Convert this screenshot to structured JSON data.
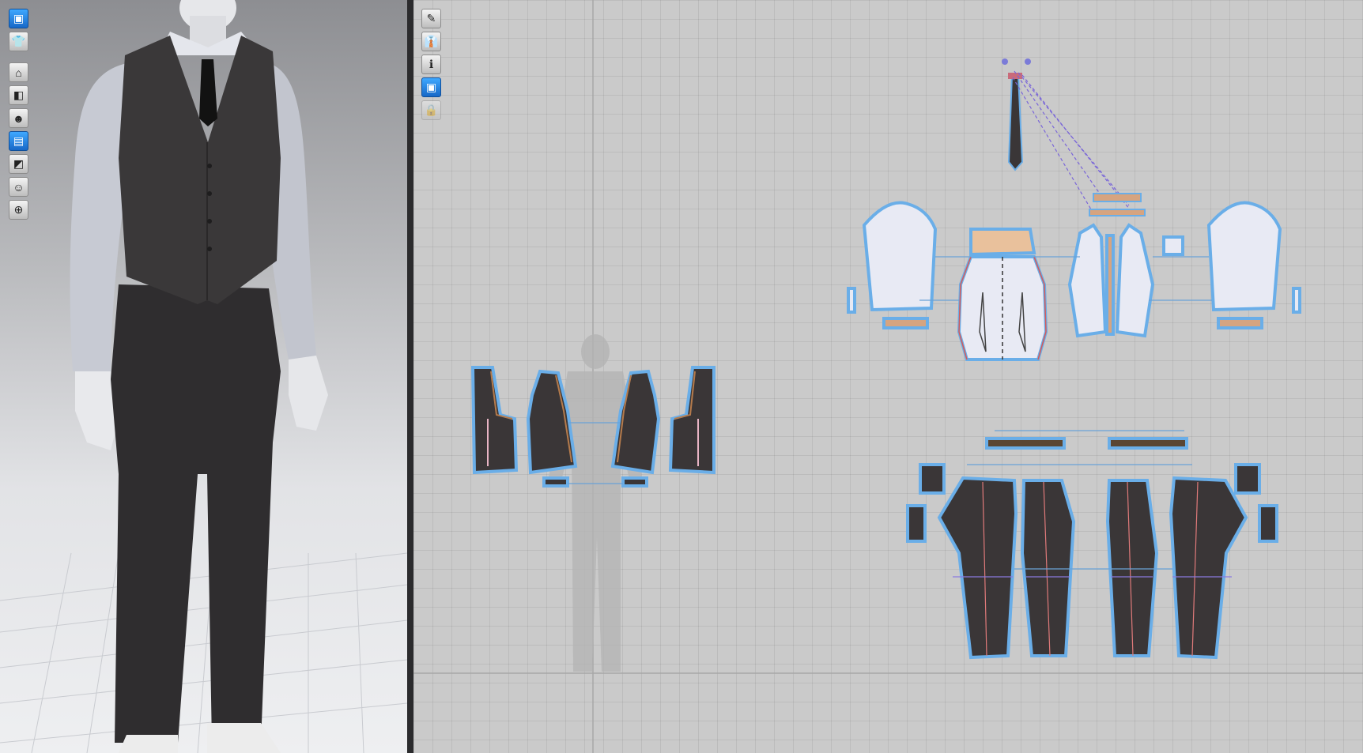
{
  "app": {
    "accent_color": "#2f8ef0",
    "pattern_outline_color": "#6aaee8",
    "fabric_dark_color": "#3a3637",
    "fabric_light_color": "#e8eaf4",
    "trim_color": "#d6a480"
  },
  "viewport_3d": {
    "toolbar": [
      {
        "name": "simulation-icon",
        "glyph": "▣",
        "active": true
      },
      {
        "name": "garment-icon",
        "glyph": "👕",
        "active": false
      },
      {
        "name": "avatar-visibility-icon",
        "glyph": "⌂",
        "active": false
      },
      {
        "name": "texture-icon",
        "glyph": "◧",
        "active": false
      },
      {
        "name": "avatar-icon",
        "glyph": "☻",
        "active": false
      },
      {
        "name": "surface-icon",
        "glyph": "▤",
        "active": true
      },
      {
        "name": "shading-icon",
        "glyph": "◩",
        "active": false
      },
      {
        "name": "skin-icon",
        "glyph": "☺",
        "active": false
      },
      {
        "name": "globe-icon",
        "glyph": "⊕",
        "active": false
      }
    ]
  },
  "viewport_2d": {
    "toolbar": [
      {
        "name": "pen-icon",
        "glyph": "✎",
        "active": false
      },
      {
        "name": "shirt-visibility-icon",
        "glyph": "👔",
        "active": false
      },
      {
        "name": "info-icon",
        "glyph": "ℹ",
        "active": false
      },
      {
        "name": "thickness-icon",
        "glyph": "▣",
        "active": true
      },
      {
        "name": "lock-icon",
        "glyph": "🔒",
        "active": false,
        "disabled": true
      }
    ]
  }
}
